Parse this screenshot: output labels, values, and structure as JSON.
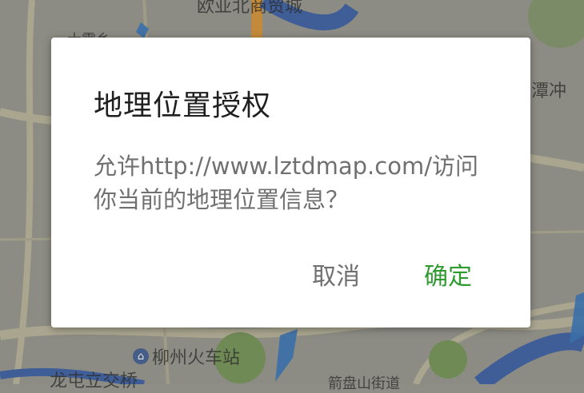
{
  "map": {
    "labels": {
      "top": "欧亚北商贸城",
      "top_left": "大霞乡",
      "right": "潭冲",
      "station": "柳州火车站",
      "bottom_left": "龙屯立交桥",
      "bottom_mid": "箭盘山街道"
    },
    "colors": {
      "land": "#8e8e86",
      "water": "#4a6aa6",
      "road": "#b7b39d",
      "park": "#6f8a55"
    }
  },
  "dialog": {
    "title": "地理位置授权",
    "message": "允许http://www.lztdmap.com/访问你当前的地理位置信息？",
    "cancel_label": "取消",
    "confirm_label": "确定",
    "accent_color": "#2f9a2f"
  }
}
